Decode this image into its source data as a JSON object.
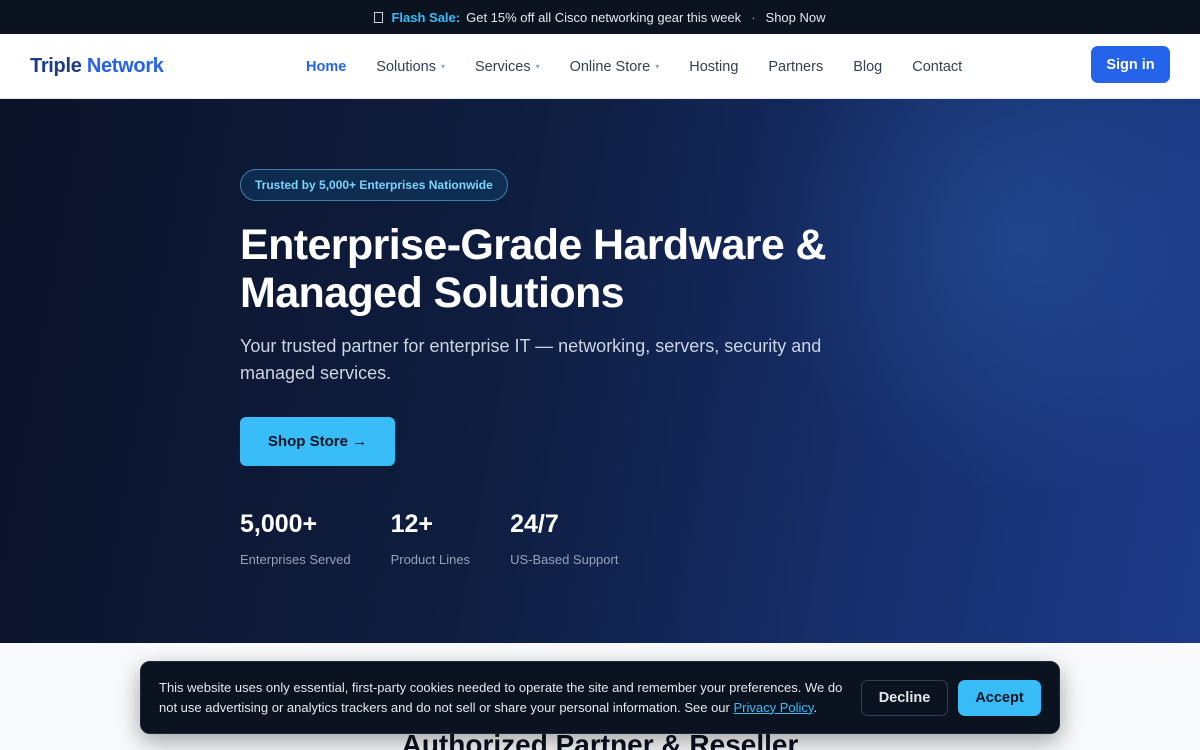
{
  "announcement": {
    "icon": "box-icon",
    "flash_label": "Flash Sale:",
    "message": "Get 15% off all Cisco networking gear this week",
    "separator": "·",
    "link_label": "Shop Now"
  },
  "header": {
    "logo_part1": "Triple",
    "logo_part2": "Network",
    "nav": [
      {
        "label": "Home",
        "active": true
      },
      {
        "label": "Solutions",
        "dropdown": true
      },
      {
        "label": "Services",
        "dropdown": true
      },
      {
        "label": "Online Store",
        "dropdown": true
      },
      {
        "label": "Hosting"
      },
      {
        "label": "Partners"
      },
      {
        "label": "Blog"
      },
      {
        "label": "Contact"
      }
    ],
    "caret": "▾",
    "signin_label": "Sign in"
  },
  "hero": {
    "badge": "Trusted by 5,000+ Enterprises Nationwide",
    "title": "Enterprise-Grade Hardware & Managed Solutions",
    "subtitle": "Your trusted partner for enterprise IT — networking, servers, security and managed services.",
    "cta_label": "Shop Store →",
    "stats": [
      {
        "value": "5,000+",
        "label": "Enterprises Served"
      },
      {
        "value": "12+",
        "label": "Product Lines"
      },
      {
        "value": "24/7",
        "label": "US-Based Support"
      }
    ]
  },
  "partners": {
    "heading": "Authorized Partner & Reseller"
  },
  "cookie": {
    "text": "This website uses only essential, first-party cookies needed to operate the site and remember your preferences. We do not use advertising or analytics trackers and do not sell or share your personal information. See our",
    "link_label": "Privacy Policy",
    "after_link": ".",
    "decline_label": "Decline",
    "accept_label": "Accept"
  },
  "colors": {
    "brand": "#2563eb",
    "accent": "#38bdf8",
    "dark": "#0b1220"
  }
}
